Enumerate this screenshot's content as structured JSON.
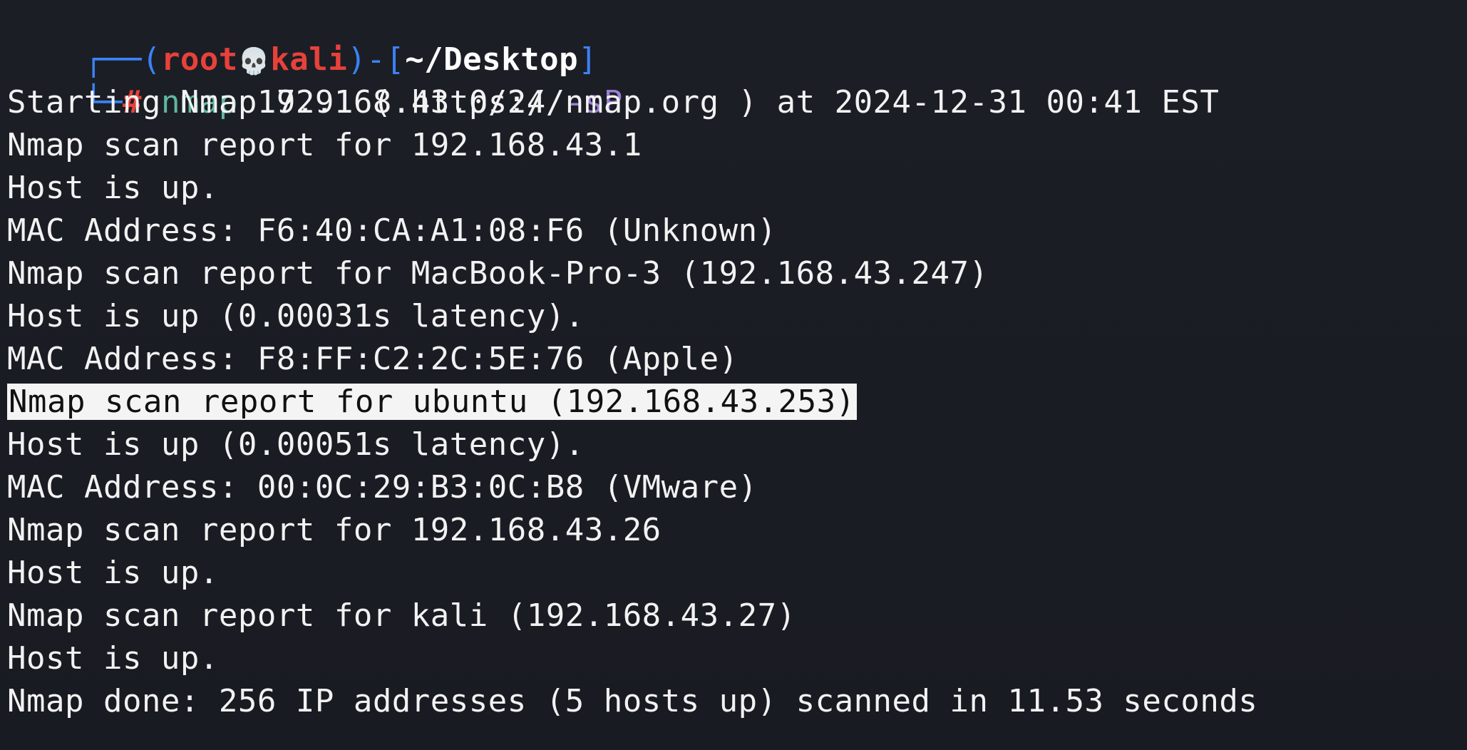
{
  "prompt": {
    "open": "┌──(",
    "user": "root",
    "skull": "💀",
    "host": "kali",
    "mid": ")-[",
    "path": "~/Desktop",
    "close": "]",
    "corner": "└─",
    "hash": "#"
  },
  "command": {
    "program": "nmap",
    "args": "192.168.43.0/24",
    "flag": "-sP"
  },
  "output": [
    "Starting Nmap 7.91 ( https://nmap.org ) at 2024-12-31 00:41 EST",
    "Nmap scan report for 192.168.43.1",
    "Host is up.",
    "MAC Address: F6:40:CA:A1:08:F6 (Unknown)",
    "Nmap scan report for MacBook-Pro-3 (192.168.43.247)",
    "Host is up (0.00031s latency).",
    "MAC Address: F8:FF:C2:2C:5E:76 (Apple)",
    "Nmap scan report for ubuntu (192.168.43.253)",
    "Host is up (0.00051s latency).",
    "MAC Address: 00:0C:29:B3:0C:B8 (VMware)",
    "Nmap scan report for 192.168.43.26",
    "Host is up.",
    "Nmap scan report for kali (192.168.43.27)",
    "Host is up.",
    "Nmap done: 256 IP addresses (5 hosts up) scanned in 11.53 seconds"
  ],
  "colors": {
    "prompt_frame": "#3b82f6",
    "user_host": "#e8413a",
    "command": "#5fb8a0",
    "flag": "#9b7fd6",
    "highlight_bg": "#f4f4f4"
  }
}
